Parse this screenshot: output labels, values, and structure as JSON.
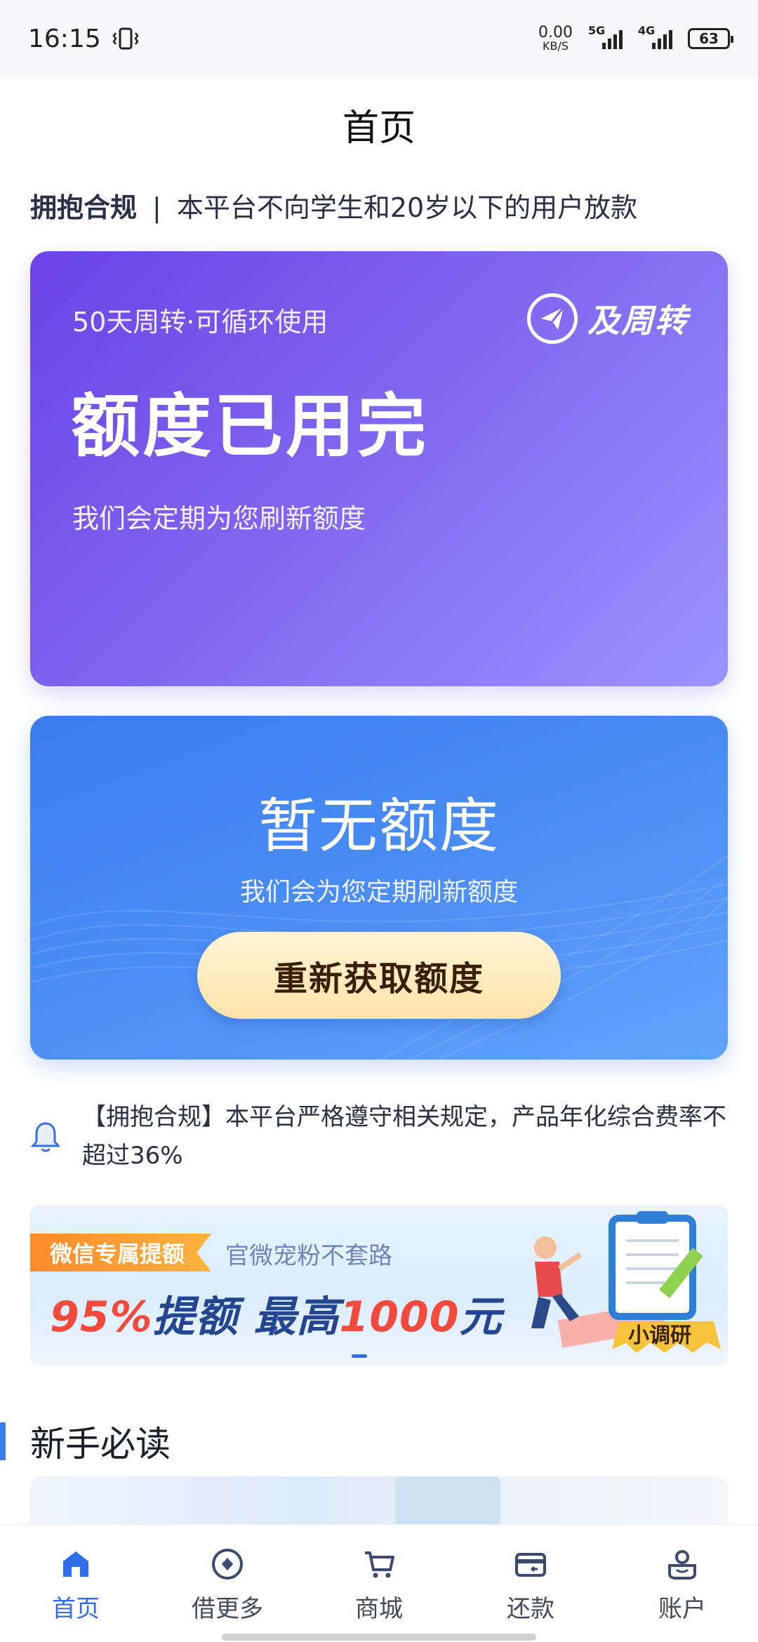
{
  "status_bar": {
    "time": "16:15",
    "net_speed_value": "0.00",
    "net_speed_unit": "KB/S",
    "signal1_gen": "5G",
    "signal2_gen": "4G",
    "battery": "63"
  },
  "header": {
    "title": "首页"
  },
  "compliance": {
    "label": "拥抱合规",
    "separator": "|",
    "text": "本平台不向学生和20岁以下的用户放款"
  },
  "quota_card": {
    "cycle_text": "50天周转·可循环使用",
    "status": "额度已用完",
    "refresh_text": "我们会定期为您刷新额度",
    "brand_name": "及周转"
  },
  "nolimit_card": {
    "headline": "暂无额度",
    "sub": "我们会为您定期刷新额度",
    "button_label": "重新获取额度"
  },
  "notice": {
    "text": "【拥抱合规】本平台严格遵守相关规定，产品年化综合费率不超过36%"
  },
  "banner": {
    "tag": "微信专属提额",
    "tag_sub": "官微宠粉不套路",
    "headline_part1": "95%",
    "headline_part2": "提额 最高",
    "headline_part3": "1000",
    "headline_part4": "元",
    "badge": "小调研"
  },
  "section": {
    "title": "新手必读"
  },
  "nav": {
    "items": [
      {
        "label": "首页",
        "icon": "home-icon",
        "active": true
      },
      {
        "label": "借更多",
        "icon": "borrow-more-icon",
        "active": false
      },
      {
        "label": "商城",
        "icon": "cart-icon",
        "active": false
      },
      {
        "label": "还款",
        "icon": "card-icon",
        "active": false
      },
      {
        "label": "账户",
        "icon": "account-icon",
        "active": false
      }
    ]
  },
  "colors": {
    "primary": "#2f6ee8",
    "purple_card": "#6a43e6",
    "blue_card": "#3b7cf0",
    "button_gold": "#ffe2a8",
    "banner_red": "#f24a3c"
  }
}
